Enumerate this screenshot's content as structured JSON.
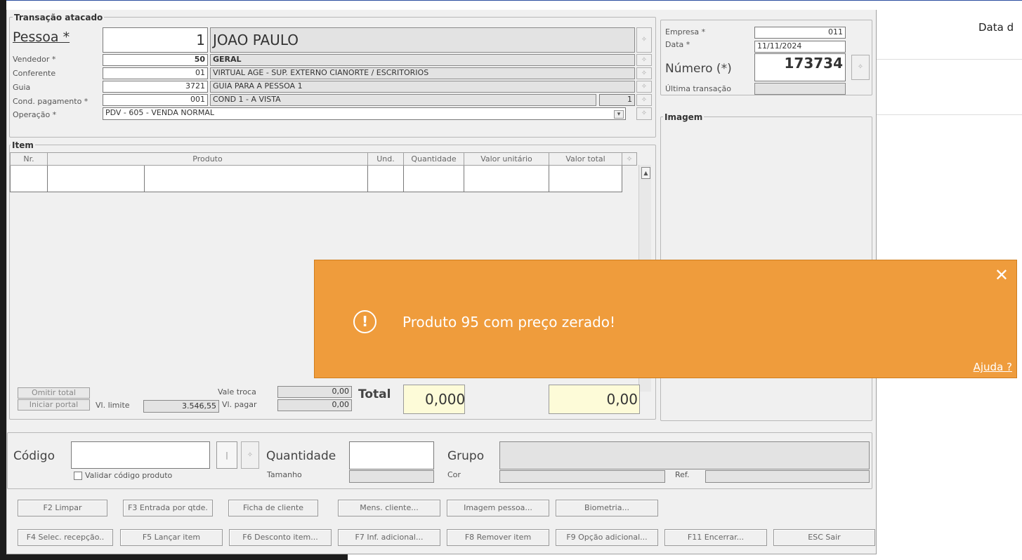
{
  "window": {
    "title": "Transação atacado"
  },
  "background": {
    "date_label": "Data d"
  },
  "header": {
    "pessoa_label": "Pessoa *",
    "pessoa_code": "1",
    "pessoa_name": "JOAO PAULO",
    "vendedor_label": "Vendedor *",
    "vendedor_code": "50",
    "vendedor_name": "GERAL",
    "conferente_label": "Conferente",
    "conferente_code": "01",
    "conferente_name": "VIRTUAL AGE - SUP. EXTERNO CIANORTE / ESCRITORIOS",
    "guia_label": "Guia",
    "guia_code": "3721",
    "guia_name": "GUIA PARA A PESSOA 1",
    "cond_label": "Cond. pagamento *",
    "cond_code": "001",
    "cond_name": "COND 1 - A VISTA",
    "cond_count": "1",
    "operacao_label": "Operação *",
    "operacao_value": "PDV - 605 - VENDA NORMAL"
  },
  "empresa": {
    "empresa_label": "Empresa *",
    "empresa_value": "011",
    "data_label": "Data *",
    "data_value": "11/11/2024",
    "numero_label": "Número (*)",
    "numero_value": "173734",
    "ultima_label": "Última transação",
    "imagem_title": "Imagem"
  },
  "item": {
    "title": "Item",
    "columns": [
      "Nr.",
      "Produto",
      "Und.",
      "Quantidade",
      "Valor unitário",
      "Valor total"
    ]
  },
  "totals": {
    "omitir_label": "Omitir total",
    "iniciar_label": "Iniciar portal",
    "vl_limite_label": "Vl. limite",
    "vl_limite_value": "3.546,55",
    "vale_troca_label": "Vale troca",
    "vale_troca_value": "0,00",
    "vl_pagar_label": "Vl. pagar",
    "vl_pagar_value": "0,00",
    "total_label": "Total",
    "total_qty": "0,000",
    "total_value": "0,00"
  },
  "codigo": {
    "codigo_label": "Código",
    "validar_label": "Validar código produto",
    "quantidade_label": "Quantidade",
    "tamanho_label": "Tamanho",
    "grupo_label": "Grupo",
    "cor_label": "Cor",
    "ref_label": "Ref.",
    "bar_button": "|"
  },
  "buttons_row1": [
    "F2 Limpar",
    "F3 Entrada por qtde.",
    "Ficha de cliente",
    "Mens. cliente...",
    "Imagem pessoa...",
    "Biometria..."
  ],
  "buttons_row2": [
    "F4 Selec. recepção..",
    "F5 Lançar item",
    "F6 Desconto item...",
    "F7 Inf. adicional...",
    "F8 Remover item",
    "F9 Opção adicional...",
    "F11 Encerrar...",
    "ESC Sair"
  ],
  "toast": {
    "message": "Produto 95 com preço zerado!",
    "close": "✕",
    "help": "Ajuda ?",
    "icon_glyph": "!",
    "color": "#ef9c3c"
  },
  "icons": {
    "lookup": "✧",
    "dropdown": "▾",
    "scroll_up": "▲"
  }
}
